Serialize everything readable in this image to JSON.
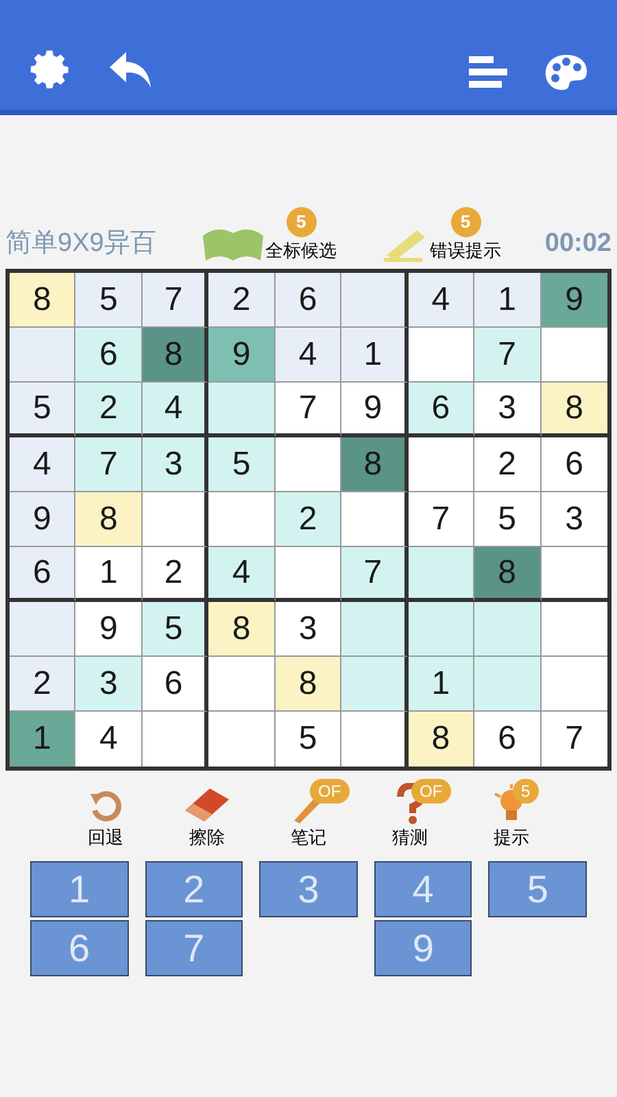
{
  "header": {
    "title": "简单9X9异百",
    "timer": "00:02"
  },
  "header_tools": [
    {
      "label": "全标候选",
      "badge": "5",
      "kind": "map"
    },
    {
      "label": "错误提示",
      "badge": "5",
      "kind": "pencil"
    }
  ],
  "grid": [
    [
      {
        "value": "8",
        "color": "#fbf3c4"
      },
      {
        "value": "5",
        "color": "#e8eef8"
      },
      {
        "value": "7",
        "color": "#e8eef8"
      },
      {
        "value": "2",
        "color": "#e8eef8"
      },
      {
        "value": "6",
        "color": "#e8eef8"
      },
      {
        "color": "#e8eef8"
      },
      {
        "value": "4",
        "color": "#e8eef8"
      },
      {
        "value": "1",
        "color": "#e8eef8"
      },
      {
        "value": "9",
        "color": "#6aa898"
      }
    ],
    [
      {
        "color": "#e8eef8"
      },
      {
        "value": "6",
        "color": "#d3f3f1"
      },
      {
        "value": "8",
        "color": "#5a9486"
      },
      {
        "value": "9",
        "color": "#7fbfb2"
      },
      {
        "value": "4",
        "color": "#e8eef8"
      },
      {
        "value": "1",
        "color": "#e8eef8"
      },
      {
        "color": "#ffffff"
      },
      {
        "value": "7",
        "color": "#d3f3f1"
      },
      {
        "color": "#ffffff"
      }
    ],
    [
      {
        "value": "5",
        "color": "#e8eef8"
      },
      {
        "value": "2",
        "color": "#d3f3f1"
      },
      {
        "value": "4",
        "color": "#d3f3f1"
      },
      {
        "color": "#d3f3f1"
      },
      {
        "value": "7",
        "color": "#ffffff"
      },
      {
        "value": "9",
        "color": "#ffffff"
      },
      {
        "value": "6",
        "color": "#d3f3f1"
      },
      {
        "value": "3",
        "color": "#ffffff"
      },
      {
        "value": "8",
        "color": "#fbf3c4"
      }
    ],
    [
      {
        "value": "4",
        "color": "#e8eef8"
      },
      {
        "value": "7",
        "color": "#d3f3f1"
      },
      {
        "value": "3",
        "color": "#d3f3f1"
      },
      {
        "value": "5",
        "color": "#d3f3f1"
      },
      {
        "color": "#ffffff"
      },
      {
        "value": "8",
        "color": "#5a9486"
      },
      {
        "color": "#ffffff"
      },
      {
        "value": "2",
        "color": "#ffffff"
      },
      {
        "value": "6",
        "color": "#ffffff"
      }
    ],
    [
      {
        "value": "9",
        "color": "#e8eef8"
      },
      {
        "value": "8",
        "color": "#fbf3c4"
      },
      {
        "color": "#ffffff"
      },
      {
        "color": "#ffffff"
      },
      {
        "value": "2",
        "color": "#d3f3f1"
      },
      {
        "color": "#ffffff"
      },
      {
        "value": "7",
        "color": "#ffffff"
      },
      {
        "value": "5",
        "color": "#ffffff"
      },
      {
        "value": "3",
        "color": "#ffffff"
      }
    ],
    [
      {
        "value": "6",
        "color": "#e8eef8"
      },
      {
        "value": "1",
        "color": "#ffffff"
      },
      {
        "value": "2",
        "color": "#ffffff"
      },
      {
        "value": "4",
        "color": "#d3f3f1"
      },
      {
        "color": "#ffffff"
      },
      {
        "value": "7",
        "color": "#d3f3f1"
      },
      {
        "color": "#d3f3f1"
      },
      {
        "value": "8",
        "color": "#5a9486"
      },
      {
        "color": "#ffffff"
      }
    ],
    [
      {
        "color": "#e8eef8"
      },
      {
        "value": "9",
        "color": "#ffffff"
      },
      {
        "value": "5",
        "color": "#d3f3f1"
      },
      {
        "value": "8",
        "color": "#fbf3c4"
      },
      {
        "value": "3",
        "color": "#ffffff"
      },
      {
        "color": "#d3f3f1"
      },
      {
        "color": "#d3f3f1"
      },
      {
        "color": "#d3f3f1"
      },
      {
        "color": "#ffffff"
      }
    ],
    [
      {
        "value": "2",
        "color": "#e8eef8"
      },
      {
        "value": "3",
        "color": "#d3f3f1"
      },
      {
        "value": "6",
        "color": "#ffffff"
      },
      {
        "color": "#ffffff"
      },
      {
        "value": "8",
        "color": "#fbf3c4"
      },
      {
        "color": "#d3f3f1"
      },
      {
        "value": "1",
        "color": "#d3f3f1"
      },
      {
        "color": "#d3f3f1"
      },
      {
        "color": "#ffffff"
      }
    ],
    [
      {
        "value": "1",
        "color": "#6aa898"
      },
      {
        "value": "4",
        "color": "#ffffff"
      },
      {
        "color": "#ffffff"
      },
      {
        "color": "#ffffff"
      },
      {
        "value": "5",
        "color": "#ffffff"
      },
      {
        "color": "#ffffff"
      },
      {
        "value": "8",
        "color": "#fbf3c4"
      },
      {
        "value": "6",
        "color": "#ffffff"
      },
      {
        "value": "7",
        "color": "#ffffff"
      }
    ]
  ],
  "tools": [
    {
      "kind": "undo",
      "label": "回退"
    },
    {
      "kind": "eraser",
      "label": "擦除"
    },
    {
      "kind": "note",
      "label": "笔记",
      "badge": "OF"
    },
    {
      "kind": "guess",
      "label": "猜测",
      "badge": "OF"
    },
    {
      "kind": "hint",
      "label": "提示",
      "badge": "5"
    }
  ],
  "keypad": [
    [
      {
        "kind": "key",
        "label": "1"
      },
      {
        "kind": "key",
        "label": "2"
      },
      {
        "kind": "key",
        "label": "3"
      },
      {
        "kind": "key",
        "label": "4"
      },
      {
        "kind": "key",
        "label": "5"
      }
    ],
    [
      {
        "kind": "key",
        "label": "6"
      },
      {
        "kind": "key",
        "label": "7"
      },
      {
        "kind": "blank"
      },
      {
        "kind": "key",
        "label": "9"
      },
      {
        "kind": "blank"
      }
    ]
  ]
}
